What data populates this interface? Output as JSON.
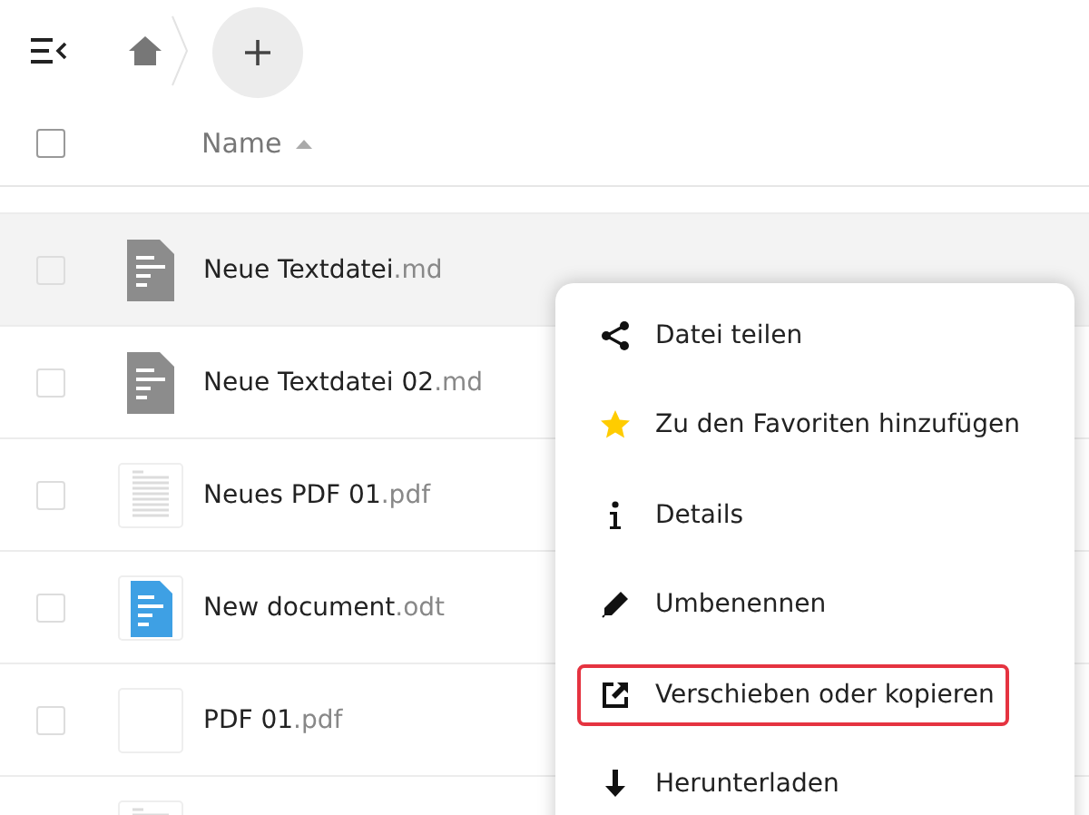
{
  "header": {
    "column_label": "Name",
    "select_all_checked": false
  },
  "files": [
    {
      "name": "Neue Textdatei",
      "extension": ".md",
      "kind": "text",
      "selected": true,
      "checked": false
    },
    {
      "name": "Neue Textdatei 02",
      "extension": ".md",
      "kind": "text",
      "selected": false,
      "checked": false
    },
    {
      "name": "Neues PDF 01",
      "extension": ".pdf",
      "kind": "pdf",
      "selected": false,
      "checked": false
    },
    {
      "name": "New document",
      "extension": ".odt",
      "kind": "document",
      "selected": false,
      "checked": false
    },
    {
      "name": "PDF 01",
      "extension": ".pdf",
      "kind": "blank",
      "selected": false,
      "checked": false
    },
    {
      "kind": "pdf",
      "selected": false
    }
  ],
  "menu": [
    {
      "label": "Datei teilen",
      "kind": "share",
      "highlighted": false
    },
    {
      "label": "Zu den Favoriten hinzufügen",
      "kind": "star",
      "highlighted": false
    },
    {
      "label": "Details",
      "kind": "info",
      "highlighted": false
    },
    {
      "label": "Umbenennen",
      "kind": "rename",
      "highlighted": false
    },
    {
      "label": "Verschieben oder kopieren",
      "kind": "move",
      "highlighted": true
    },
    {
      "label": "Herunterladen",
      "kind": "download",
      "highlighted": false
    }
  ]
}
